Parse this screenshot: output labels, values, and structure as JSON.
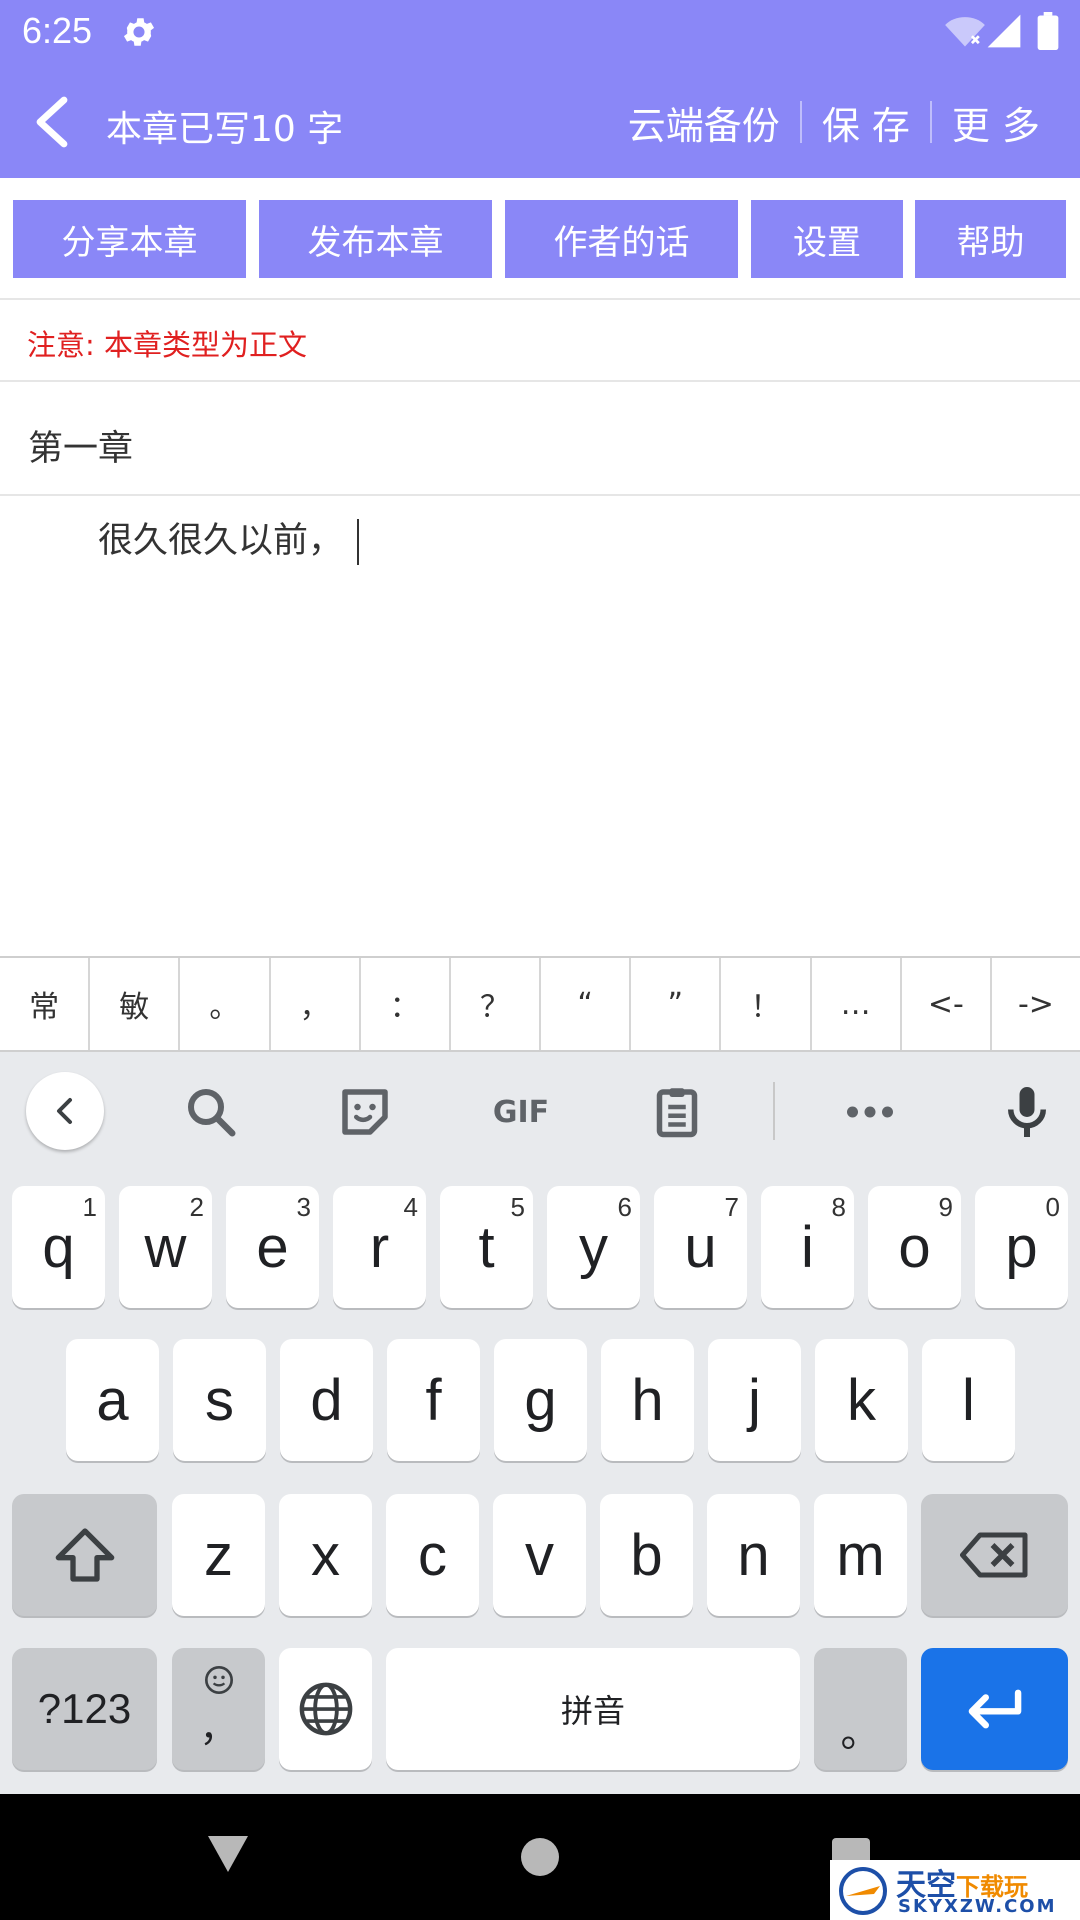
{
  "status_bar": {
    "time": "6:25"
  },
  "header": {
    "title": "本章已写10 字",
    "actions": {
      "cloud_backup": "云端备份",
      "save": "保 存",
      "more": "更 多"
    }
  },
  "toolbar": {
    "share": "分享本章",
    "publish": "发布本章",
    "author_note": "作者的话",
    "settings": "设置",
    "help": "帮助"
  },
  "notice": "注意: 本章类型为正文",
  "chapter_title": "第一章",
  "body_text": "很久很久以前，",
  "punctuation": [
    "常",
    "敏",
    "。",
    "，",
    "：",
    "？",
    "“",
    "”",
    "！",
    "…",
    "<-",
    "->"
  ],
  "keyboard": {
    "toolbar_gif": "GIF",
    "row1": [
      {
        "key": "q",
        "hint": "1"
      },
      {
        "key": "w",
        "hint": "2"
      },
      {
        "key": "e",
        "hint": "3"
      },
      {
        "key": "r",
        "hint": "4"
      },
      {
        "key": "t",
        "hint": "5"
      },
      {
        "key": "y",
        "hint": "6"
      },
      {
        "key": "u",
        "hint": "7"
      },
      {
        "key": "i",
        "hint": "8"
      },
      {
        "key": "o",
        "hint": "9"
      },
      {
        "key": "p",
        "hint": "0"
      }
    ],
    "row2": [
      "a",
      "s",
      "d",
      "f",
      "g",
      "h",
      "j",
      "k",
      "l"
    ],
    "row3": [
      "z",
      "x",
      "c",
      "v",
      "b",
      "n",
      "m"
    ],
    "symbols_key": "?123",
    "comma_key": "，",
    "space_key": "拼音",
    "period_key": "。"
  },
  "watermark": {
    "cn_main": "天空",
    "cn_sub": "下载玩",
    "en": "SKYXZW.COM"
  },
  "colors": {
    "accent": "#8a87f7",
    "notice": "#e02020",
    "enter": "#1a73e8"
  }
}
